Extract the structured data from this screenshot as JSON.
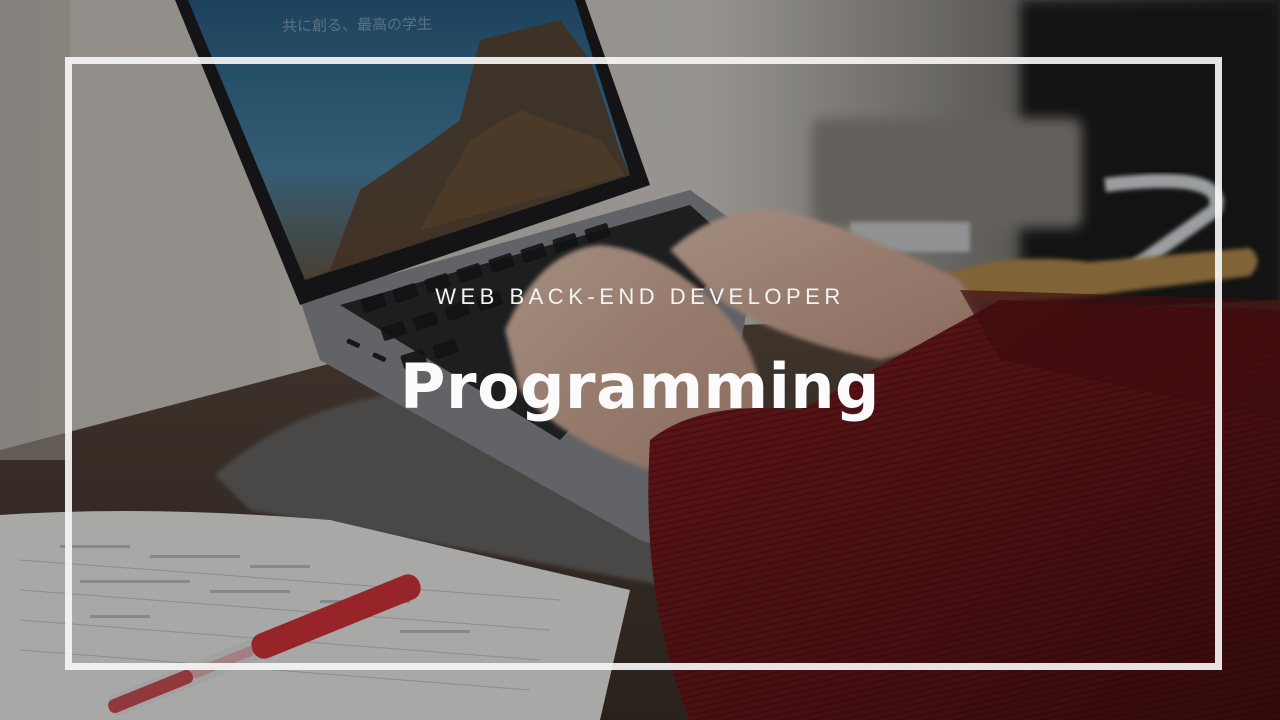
{
  "banner": {
    "subtitle": "WEB BACK-END DEVELOPER",
    "title": "Programming",
    "screen_caption": "共に創る、最高の学生"
  },
  "colors": {
    "frame": "#f5f5f5",
    "text": "#ffffff",
    "sweater": "#8a1f22",
    "pen": "#d8343a"
  }
}
